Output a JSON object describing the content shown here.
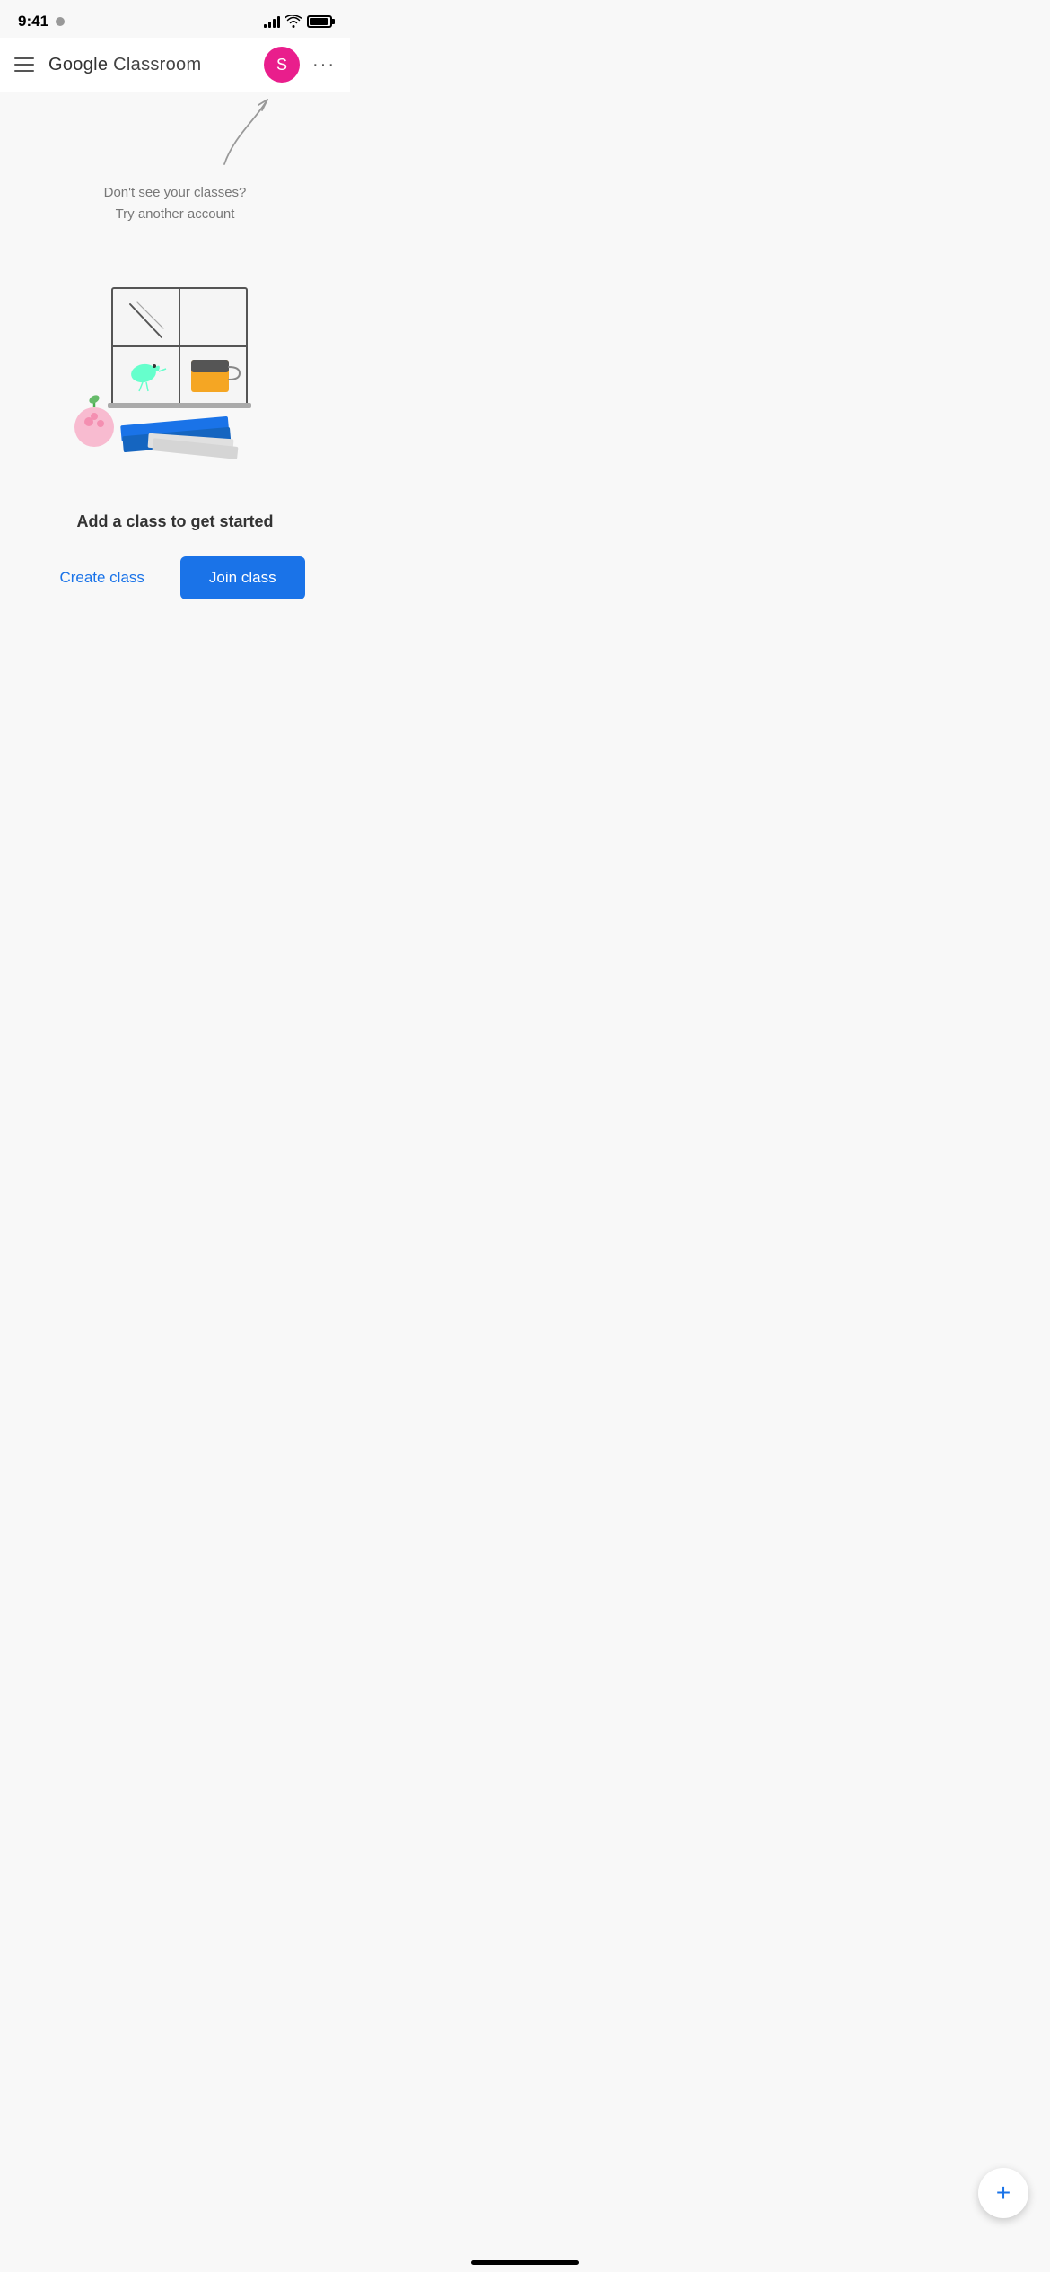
{
  "statusBar": {
    "time": "9:41",
    "dot_aria": "camera active"
  },
  "header": {
    "title_google": "Google",
    "title_app": "Classroom",
    "avatar_letter": "S",
    "menu_aria": "menu",
    "more_aria": "more options"
  },
  "hint": {
    "line1": "Don't see your classes?",
    "line2": "Try another account"
  },
  "illustration": {
    "aria": "Empty classroom illustration"
  },
  "cta": {
    "heading": "Add a class to get started",
    "create_label": "Create class",
    "join_label": "Join class"
  },
  "fab": {
    "label": "+"
  }
}
